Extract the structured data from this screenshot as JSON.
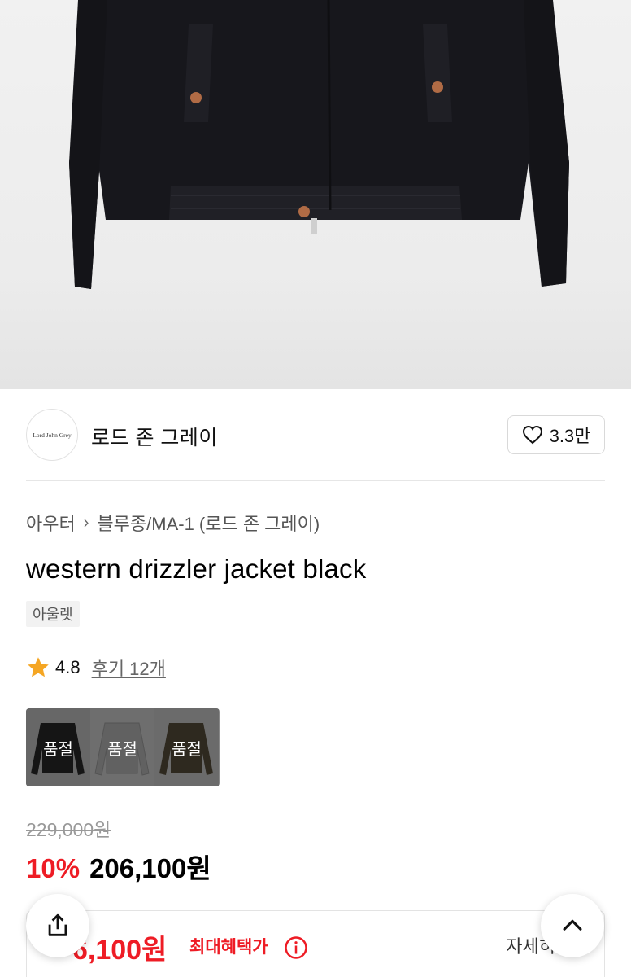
{
  "brand": {
    "logo_text": "Lord John Grey",
    "name": "로드 존 그레이",
    "like_count": "3.3만"
  },
  "breadcrumb": {
    "category": "아우터",
    "subcategory": "블루종/MA-1 (로드 존 그레이)"
  },
  "product": {
    "title": "western drizzler jacket black",
    "badge": "아울렛",
    "rating": "4.8",
    "reviews": "후기 12개"
  },
  "variants": [
    {
      "label": "품절",
      "color": "#1c1c1c"
    },
    {
      "label": "품절",
      "color": "#7a7a7a"
    },
    {
      "label": "품절",
      "color": "#3b3528"
    }
  ],
  "pricing": {
    "original": "229,000원",
    "discount": "10%",
    "sale": "206,100원"
  },
  "benefit": {
    "price": "6,100원",
    "label": "최대혜택가",
    "detail": "자세히"
  },
  "icons": {
    "like": "heart-outline-icon",
    "star": "star-icon",
    "info": "info-circle-icon",
    "share": "share-icon",
    "top": "chevron-up-icon"
  },
  "colors": {
    "accent_red": "#ee1c25",
    "star_gold": "#f5a623"
  }
}
